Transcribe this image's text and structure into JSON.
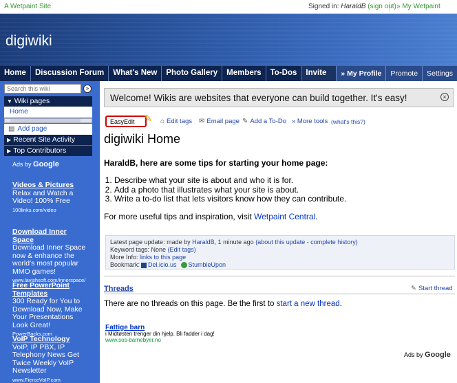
{
  "topbar": {
    "site_label": "A Wetpaint Site",
    "signed_in_prefix": "Signed in:",
    "user": "HaraldB",
    "sign_out": "(sign out)",
    "my_wetpaint": "»  My Wetpaint"
  },
  "header": {
    "title": "digiwiki"
  },
  "nav": {
    "items": [
      "Home",
      "Discussion Forum",
      "What's New",
      "Photo Gallery",
      "Members",
      "To-Dos",
      "Invite"
    ],
    "right": [
      "» My Profile",
      "Promote",
      "Settings"
    ]
  },
  "sidebar": {
    "search_placeholder": "Search this wiki",
    "search_go": "»",
    "wiki_pages": "Wiki pages",
    "home": "Home",
    "add_page": "Add page",
    "recent_activity": "Recent Site Activity",
    "top_contributors": "Top Contributors",
    "ads_by": "Ads by",
    "google": "Google",
    "ads": [
      {
        "title": "Videos & Pictures",
        "body": "Relax and Watch a Video! 100% Free",
        "url": "100links.com/video"
      },
      {
        "title": "Download Inner Space",
        "body": "Download Inner Space now & enhance the world's most popular MMO games!",
        "url": "www.lavishsoft.com/innerspace/"
      },
      {
        "title": "Free PowerPoint Templates",
        "body": "300 Ready for You to Download Now, Make Your Presentations Look Great!",
        "url": "PowerBacks.com"
      },
      {
        "title": "VoIP Technology",
        "body": "VoIP, IP PBX, IP Telephony News Get Twice Weekly VoIP Newsletter",
        "url": "www.FierceVoIP.com"
      }
    ]
  },
  "main": {
    "welcome": "Welcome! Wikis are websites that everyone can build together. It's easy!",
    "close": "×",
    "toolbar": {
      "easyedit": "EasyEdit",
      "edit_tags": "Edit tags",
      "email_page": "Email page",
      "add_todo": "Add a To-Do",
      "more_tools": "» More tools",
      "whats_this": "(what's this?)"
    },
    "title": "digiwiki Home",
    "tips_heading": "HaraldB, here are some tips for starting your home page:",
    "tips": [
      "Describe what your site is about and who it is for.",
      "Add a photo that illustrates what your site is about.",
      "Write a to-do list that lets visitors know how they can contribute."
    ],
    "more_prefix": "For more useful tips and inspiration, visit",
    "more_link": "Wetpaint Central",
    "more_suffix": ".",
    "info": {
      "last_update_prefix": "Latest page update: made by",
      "last_update_user": "HaraldB",
      "last_update_time": ", 1 minute ago",
      "about_update": "(about this update",
      "dash": " - ",
      "complete_history": "complete history)",
      "keyword_tags": "Keyword tags: None",
      "edit_tags": "(Edit tags)",
      "more_info": "More Info:",
      "links_to_page": "links to this page",
      "bookmark": "Bookmark:",
      "delicious": "Del.icio.us",
      "stumbleupon": "StumbleUpon"
    },
    "threads": "Threads",
    "start_thread": "Start thread",
    "no_threads_prefix": "There are no threads on this page. Be the first to",
    "new_thread": "start a new thread",
    "no_threads_suffix": ".",
    "bottom_ad": {
      "title": "Fattige barn",
      "body": "i Midtøsten trenger din hjelp. Bli fadder i dag!",
      "url": "www.sos-barnebyer.no"
    },
    "ads_by": "Ads by",
    "google": "Google"
  }
}
